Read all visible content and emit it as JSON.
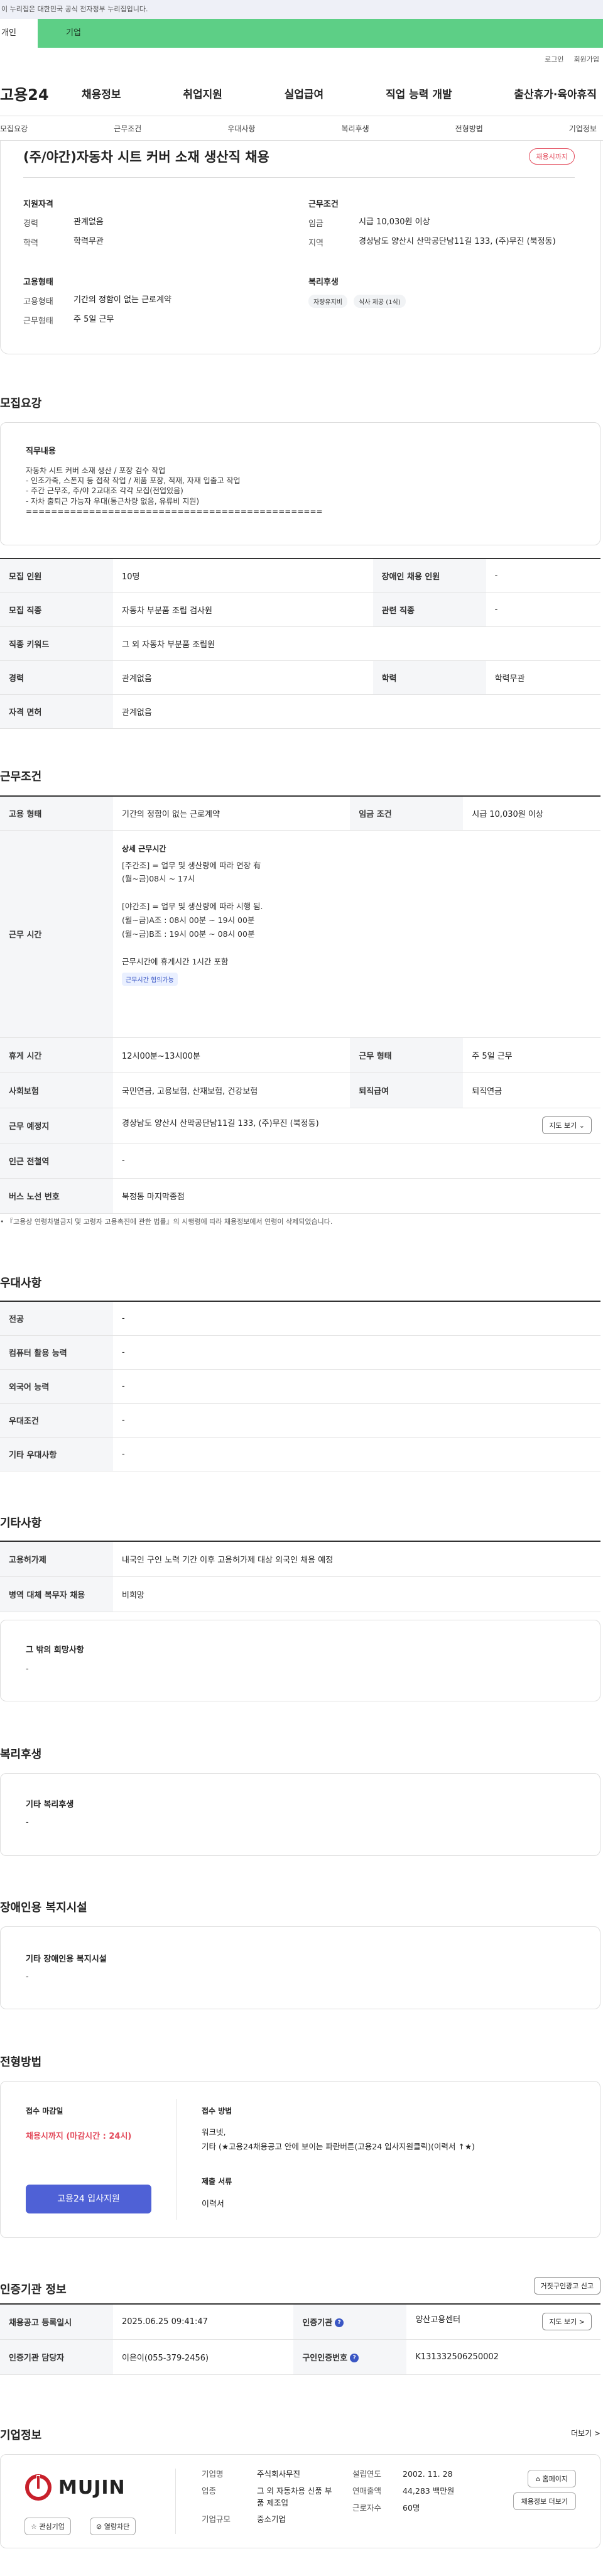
{
  "gov_banner": "이 누리집은 대한민국 공식 전자정부 누리집입니다.",
  "top_tabs": [
    "개인",
    "기업"
  ],
  "util_links": [
    "로그인",
    "회원가입"
  ],
  "logo": "고용24",
  "gnb": [
    "채용정보",
    "취업지원",
    "실업급여",
    "직업 능력 개발",
    "출산휴가·육아휴직"
  ],
  "subnav": [
    "모집요강",
    "근무조건",
    "우대사항",
    "복리후생",
    "전형방법",
    "기업정보"
  ],
  "job": {
    "title": "(주/야간)자동차 시트 커버 소재 생산직 채용",
    "status_badge": "채용시까지",
    "qual_heading": "지원자격",
    "career_k": "경력",
    "career_v": "관계없음",
    "edu_k": "학력",
    "edu_v": "학력무관",
    "emp_heading": "고용형태",
    "emptype_k": "고용형태",
    "emptype_v": "기간의 정함이 없는 근로계약",
    "workform_k": "근무형태",
    "workform_v": "주 5일 근무",
    "cond_heading": "근무조건",
    "wage_k": "임금",
    "wage_v": "시급 10,030원 이상",
    "loc_k": "지역",
    "loc_v": "경상남도 양산시 산막공단남11길 133, (주)무진 (북정동)",
    "welfare_heading": "복리후생",
    "welfare_chips": [
      "자량유지비",
      "식사 제공 (1식)"
    ]
  },
  "recruit": {
    "heading": "모집요강",
    "duty_heading": "직무내용",
    "duty_text": "자동차 시트 커버 소재 생산 / 포장 검수 작업\n- 인조가죽, 스폰지 등 접착 작업 / 제품 포장, 적재, 자재 입출고 작업\n- 주간 근무조, 주/야 2교대조 각각 모집(전업있음)\n- 자차 출퇴근 가능자 우대(통근차량 없음, 유류비 지원)\n===============================================",
    "rows": [
      {
        "k1": "모집 인원",
        "v1": "10명",
        "k2": "장애인 채용 인원",
        "v2": "-"
      },
      {
        "k1": "모집 직종",
        "v1": "자동차 부분품 조립 검사원",
        "k2": "관련 직종",
        "v2": "-"
      },
      {
        "k1": "직종 키워드",
        "v1": "그 외 자동차 부분품 조립원",
        "k2": "",
        "v2": ""
      },
      {
        "k1": "경력",
        "v1": "관계없음",
        "k2": "학력",
        "v2": "학력무관"
      },
      {
        "k1": "자격 면허",
        "v1": "관계없음",
        "k2": "",
        "v2": ""
      }
    ]
  },
  "work": {
    "heading": "근무조건",
    "emp_k": "고용 형태",
    "emp_v": "기간의 정함이 없는 근로계약",
    "wage_k": "임금 조건",
    "wage_v": "시급 10,030원 이상",
    "hours_k": "근무 시간",
    "hours_title": "상세 근무시간",
    "hours_text": "[주간조] = 업무 및 생산량에 따라 연장 有\n(월~금)08시 ~ 17시\n\n[야간조] = 업무 및 생산량에 따라 시행 됨.\n(월~금)A조 : 08시 00분 ~ 19시 00분\n(월~금)B조 : 19시 00분 ~ 08시 00분\n\n근무시간에 휴게시간 1시간 포함",
    "hours_tag": "근무시간 협의가능",
    "break_k": "휴게 시간",
    "break_v": "12시00분~13시00분",
    "form_k": "근무 형태",
    "form_v": "주 5일 근무",
    "ins_k": "사회보험",
    "ins_v": "국민연금, 고용보험, 산재보험, 건강보험",
    "sev_k": "퇴직급여",
    "sev_v": "퇴직연금",
    "place_k": "근무 예정지",
    "place_v": "경상남도 양산시 산막공단남11길 133, (주)무진 (북정동)",
    "map_btn": "지도 보기 ⌄",
    "subway_k": "인근 전철역",
    "subway_v": "-",
    "bus_k": "버스 노선 번호",
    "bus_v": "북정동 마지막종점",
    "note": "• 『고용상 연령차별금지 및 고령자 고용촉진에 관한 법률』의 시행령에 따라 채용정보에서 연령이 삭제되었습니다."
  },
  "pref": {
    "heading": "우대사항",
    "rows": [
      {
        "k": "전공",
        "v": "-"
      },
      {
        "k": "컴퓨터 활용 능력",
        "v": "-"
      },
      {
        "k": "외국어 능력",
        "v": "-"
      },
      {
        "k": "우대조건",
        "v": "-"
      },
      {
        "k": "기타 우대사항",
        "v": "-"
      }
    ]
  },
  "etc": {
    "heading": "기타사항",
    "rows": [
      {
        "k": "고용허가제",
        "v": "내국인 구인 노력 기간 이후 고용허가제 대상 외국인 채용 예정"
      },
      {
        "k": "병역 대체 복무자 채용",
        "v": "비희망"
      }
    ],
    "box_title": "그 밖의 희망사항",
    "box_value": "-"
  },
  "welfare": {
    "heading": "복리후생",
    "box_title": "기타 복리후생",
    "box_value": "-"
  },
  "disab": {
    "heading": "장애인용 복지시설",
    "box_title": "기타 장애인용 복지시설",
    "box_value": "-"
  },
  "apply": {
    "heading": "전형방법",
    "deadline_title": "접수 마감일",
    "deadline_value": "채용시까지 (마감시간 : 24시)",
    "apply_btn": "고용24 입사지원",
    "method_title": "접수 방법",
    "method_value": "워크넷,\n기타 (★고용24채용공고 안에 보이는 파란버튼(고용24 입사지원클릭)(이력서 ↑★)",
    "docs_title": "제출 서류",
    "docs_value": "이력서"
  },
  "cert": {
    "heading": "인증기관 정보",
    "report_btn": "거짓구인광고 신고",
    "rows": [
      {
        "k1": "채용공고 등록일시",
        "v1": "2025.06.25 09:41:47",
        "k2": "인증기관",
        "v2": "양산고용센터",
        "btn": "지도 보기 >"
      },
      {
        "k1": "인증기관 담당자",
        "v1": "이은이(055-379-2456)",
        "k2": "구인인증번호",
        "v2": "K131332506250002",
        "btn": ""
      }
    ]
  },
  "company": {
    "heading": "기업정보",
    "more": "더보기 >",
    "logo_text": "MUJIN",
    "fav_btn": "☆ 관심기업",
    "block_btn": "⊘ 열람차단",
    "name_k": "기업명",
    "name_v": "주식회사무진",
    "ind_k": "업종",
    "ind_v": "그 외 자동차용 신품 부품 제조업",
    "size_k": "기업규모",
    "size_v": "중소기업",
    "est_k": "설립연도",
    "est_v": "2002. 11. 28",
    "sales_k": "연매출액",
    "sales_v": "44,283 백만원",
    "emp_k": "근로자수",
    "emp_v": "60명",
    "home_btn": "⌂ 홈페이지",
    "list_btn": "채용정보 더보기"
  }
}
